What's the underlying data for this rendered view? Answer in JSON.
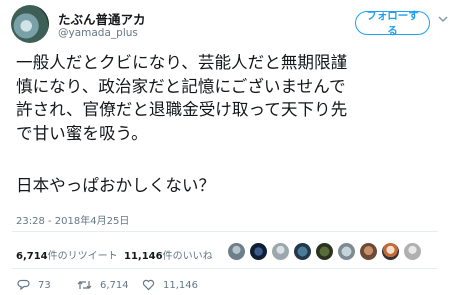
{
  "author": {
    "name": "たぶん普通アカ",
    "handle": "@yamada_plus"
  },
  "follow_button": "フォローする",
  "tweet_lines": [
    "一般人だとクビになり、芸能人だと無期限謹",
    "慎になり、政治家だと記憶にございませんで",
    "許され、官僚だと退職金受け取って天下り先",
    "で甘い蜜を吸う。",
    "",
    "日本やっぱおかしくない？"
  ],
  "timestamp": "23:28 - 2018年4月25日",
  "stats": {
    "retweets_count": "6,714",
    "retweets_label": "件のリツイート",
    "likes_count": "11,146",
    "likes_label": "件のいいね"
  },
  "actions": {
    "replies": "73",
    "retweets": "6,714",
    "likes": "11,146"
  },
  "colors": {
    "accent": "#1da1f2",
    "muted": "#657786"
  }
}
